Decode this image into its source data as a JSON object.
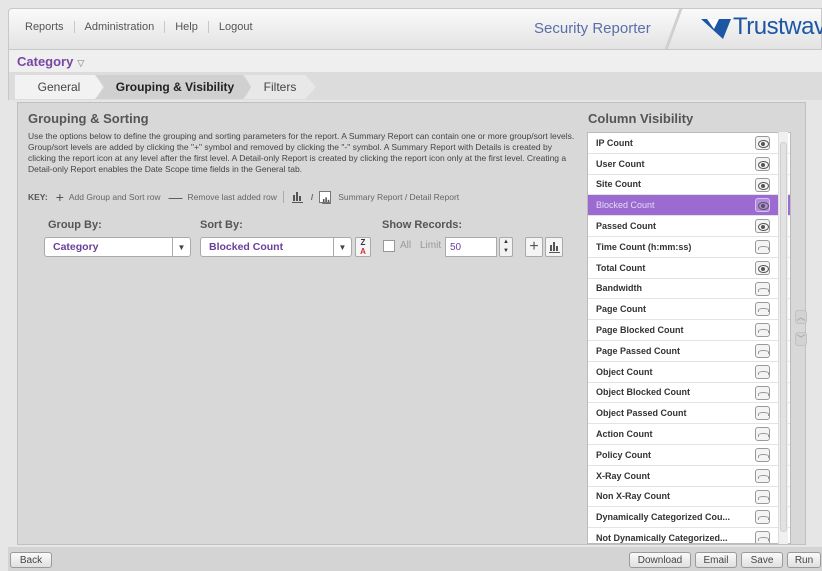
{
  "nav": {
    "items": [
      "Reports",
      "Administration",
      "Help",
      "Logout"
    ],
    "app_title": "Security Reporter",
    "brand": "Trustwave"
  },
  "category": {
    "title": "Category"
  },
  "tabs": [
    "General",
    "Grouping & Visibility",
    "Filters"
  ],
  "grouping": {
    "title": "Grouping & Sorting",
    "description": "Use the options below to define the grouping and sorting parameters for the report. A Summary Report can contain one or more group/sort levels. Group/sort levels are added by clicking the \"+\" symbol and removed by clicking the \"-\" symbol. A Summary Report with Details is created by clicking the report icon at any level after the first level. A Detail-only Report is created by clicking the report icon only at the first level. Creating a Detail-only Report enables the Date Scope time fields in the General tab.",
    "key": {
      "label": "KEY:",
      "add": "Add Group and Sort row",
      "remove": "Remove last added row",
      "slash": "/",
      "summary": "Summary Report / Detail Report"
    },
    "group_by_label": "Group By:",
    "sort_by_label": "Sort By:",
    "show_records_label": "Show Records:",
    "group_by_value": "Category",
    "sort_by_value": "Blocked Count",
    "all_label": "All",
    "limit_label": "Limit",
    "limit_value": "50"
  },
  "column_visibility": {
    "title": "Column Visibility",
    "columns": [
      {
        "name": "IP Count",
        "visible": true
      },
      {
        "name": "User Count",
        "visible": true
      },
      {
        "name": "Site Count",
        "visible": true
      },
      {
        "name": "Blocked Count",
        "visible": true,
        "selected": true
      },
      {
        "name": "Passed Count",
        "visible": true
      },
      {
        "name": "Time Count (h:mm:ss)",
        "visible": false
      },
      {
        "name": "Total Count",
        "visible": true
      },
      {
        "name": "Bandwidth",
        "visible": false
      },
      {
        "name": "Page Count",
        "visible": false
      },
      {
        "name": "Page Blocked Count",
        "visible": false
      },
      {
        "name": "Page Passed Count",
        "visible": false
      },
      {
        "name": "Object Count",
        "visible": false
      },
      {
        "name": "Object Blocked Count",
        "visible": false
      },
      {
        "name": "Object Passed Count",
        "visible": false
      },
      {
        "name": "Action Count",
        "visible": false
      },
      {
        "name": "Policy Count",
        "visible": false
      },
      {
        "name": "X-Ray Count",
        "visible": false
      },
      {
        "name": "Non X-Ray Count",
        "visible": false
      },
      {
        "name": "Dynamically Categorized Cou...",
        "visible": false
      },
      {
        "name": "Not Dynamically Categorized...",
        "visible": false
      }
    ]
  },
  "footer": {
    "back": "Back",
    "download": "Download",
    "email": "Email",
    "save": "Save",
    "run": "Run"
  },
  "colors": {
    "accent": "#7747a3",
    "selected_row": "#9b6bd2",
    "brand": "#1d57a3"
  }
}
